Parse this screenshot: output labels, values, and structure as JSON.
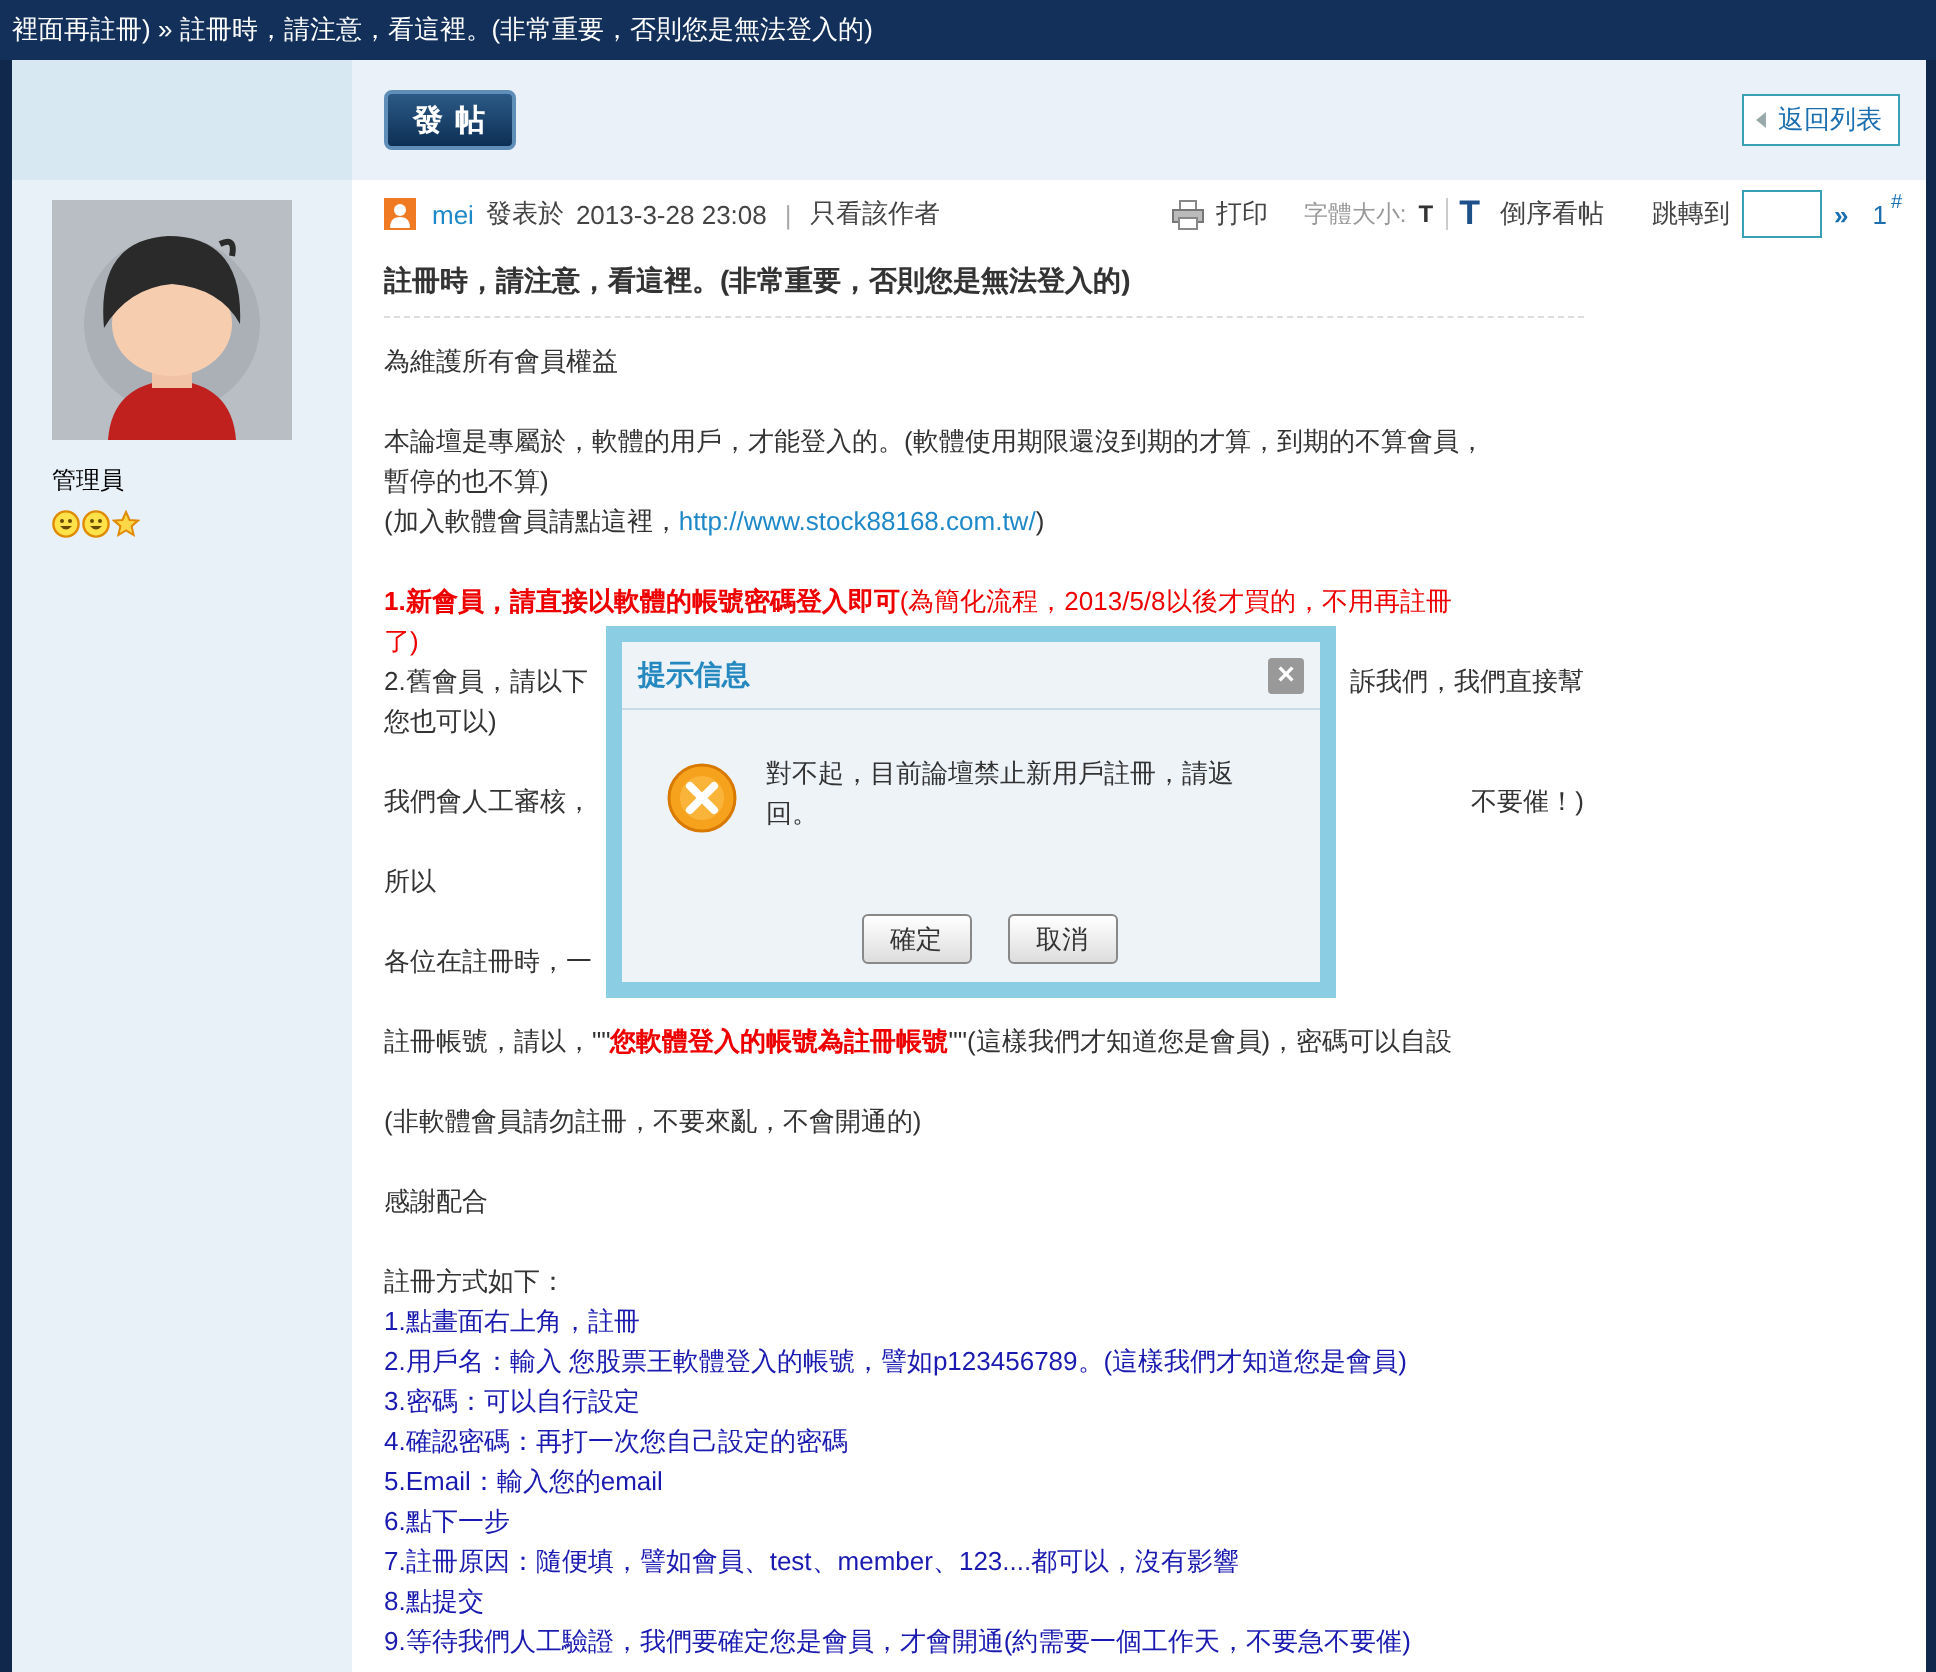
{
  "breadcrumb": "裡面再註冊) » 註冊時，請注意，看這裡。(非常重要，否則您是無法登入的)",
  "toolbar": {
    "post_button": "發 帖",
    "back_button": "返回列表"
  },
  "author_panel": {
    "role": "管理員",
    "badges": [
      {
        "kind": "smiley"
      },
      {
        "kind": "smiley"
      },
      {
        "kind": "star"
      }
    ]
  },
  "post_header": {
    "author": "mei",
    "posted_label": "發表於",
    "date": "2013-3-28 23:08",
    "separator": "|",
    "only_author": "只看該作者",
    "print": "打印",
    "font_size_label": "字體大小:",
    "font_size_t": "T",
    "reverse_icon": "T",
    "reverse": "倒序看帖",
    "jump_label": "跳轉到",
    "jump_arrow": "»",
    "floor": "1",
    "floor_mark": "#"
  },
  "post": {
    "title": "註冊時，請注意，看這裡。(非常重要，否則您是無法登入的)",
    "paragraphs": [
      [
        {
          "kind": "text",
          "segments": [
            {
              "kind": "plain",
              "text": "為維護所有會員權益"
            }
          ]
        }
      ],
      [
        {
          "kind": "text",
          "segments": [
            {
              "kind": "plain",
              "text": "本論壇是專屬於，軟體的用戶，才能登入的。(軟體使用期限還沒到期的才算，到期的不算會員，"
            }
          ]
        },
        {
          "kind": "text",
          "segments": [
            {
              "kind": "plain",
              "text": "暫停的也不算)"
            }
          ]
        },
        {
          "kind": "text",
          "segments": [
            {
              "kind": "plain",
              "text": "(加入軟體會員請點這裡，"
            },
            {
              "kind": "link",
              "text": "http://www.stock88168.com.tw/"
            },
            {
              "kind": "plain",
              "text": ")"
            }
          ]
        }
      ],
      [
        {
          "kind": "text",
          "segments": [
            {
              "kind": "red_bold",
              "text": "1.新會員，請直接以軟體的帳號密碼登入即可"
            },
            {
              "kind": "red",
              "text": "(為簡化流程，2013/5/8以後才買的，不用再註冊"
            }
          ]
        },
        {
          "kind": "text",
          "segments": [
            {
              "kind": "red",
              "text": "了)"
            }
          ]
        },
        {
          "kind": "covered",
          "left": "2.舊會員，請以下",
          "right": "訴我們，我們直接幫"
        },
        {
          "kind": "text",
          "segments": [
            {
              "kind": "plain",
              "text": "您也可以)"
            }
          ]
        }
      ],
      [
        {
          "kind": "covered",
          "left": "我們會人工審核，",
          "right": "不要催！)"
        }
      ],
      [
        {
          "kind": "text",
          "segments": [
            {
              "kind": "plain",
              "text": "所以"
            }
          ]
        }
      ],
      [
        {
          "kind": "text",
          "segments": [
            {
              "kind": "plain",
              "text": "各位在註冊時，一"
            }
          ]
        }
      ],
      [
        {
          "kind": "text",
          "segments": [
            {
              "kind": "plain",
              "text": "註冊帳號，請以，\"\""
            },
            {
              "kind": "red_bold",
              "text": "您軟體登入的帳號為註冊帳號"
            },
            {
              "kind": "plain",
              "text": "\"\"(這樣我們才知道您是會員)，密碼可以自設"
            }
          ]
        }
      ],
      [
        {
          "kind": "text",
          "segments": [
            {
              "kind": "plain",
              "text": "(非軟體會員請勿註冊，不要來亂，不會開通的)"
            }
          ]
        }
      ],
      [
        {
          "kind": "text",
          "segments": [
            {
              "kind": "plain",
              "text": "感謝配合"
            }
          ]
        }
      ],
      [
        {
          "kind": "text",
          "segments": [
            {
              "kind": "plain",
              "text": "註冊方式如下："
            }
          ]
        },
        {
          "kind": "text",
          "segments": [
            {
              "kind": "blue",
              "text": "1.點畫面右上角，註冊"
            }
          ]
        },
        {
          "kind": "text",
          "segments": [
            {
              "kind": "blue",
              "text": "2.用戶名：輸入 您股票王軟體登入的帳號，譬如p123456789。(這樣我們才知道您是會員)"
            }
          ]
        },
        {
          "kind": "text",
          "segments": [
            {
              "kind": "blue",
              "text": "3.密碼：可以自行設定"
            }
          ]
        },
        {
          "kind": "text",
          "segments": [
            {
              "kind": "blue",
              "text": "4.確認密碼：再打一次您自己設定的密碼"
            }
          ]
        },
        {
          "kind": "text",
          "segments": [
            {
              "kind": "blue",
              "text": "5.Email：輸入您的email"
            }
          ]
        },
        {
          "kind": "text",
          "segments": [
            {
              "kind": "blue",
              "text": "6.點下一步"
            }
          ]
        },
        {
          "kind": "text",
          "segments": [
            {
              "kind": "blue",
              "text": "7.註冊原因：隨便填，譬如會員、test、member、123....都可以，沒有影響"
            }
          ]
        },
        {
          "kind": "text",
          "segments": [
            {
              "kind": "blue",
              "text": "8.點提交"
            }
          ]
        },
        {
          "kind": "text",
          "segments": [
            {
              "kind": "blue",
              "text": "9.等待我們人工驗證，我們要確定您是會員，才會開通(約需要一個工作天，不要急不要催)"
            }
          ]
        }
      ]
    ]
  },
  "dialog": {
    "title": "提示信息",
    "close": "×",
    "message_line1": "對不起，目前論壇禁止新用戶註冊，請返",
    "message_line2": "回。",
    "buttons": [
      "確定",
      "取消"
    ]
  }
}
